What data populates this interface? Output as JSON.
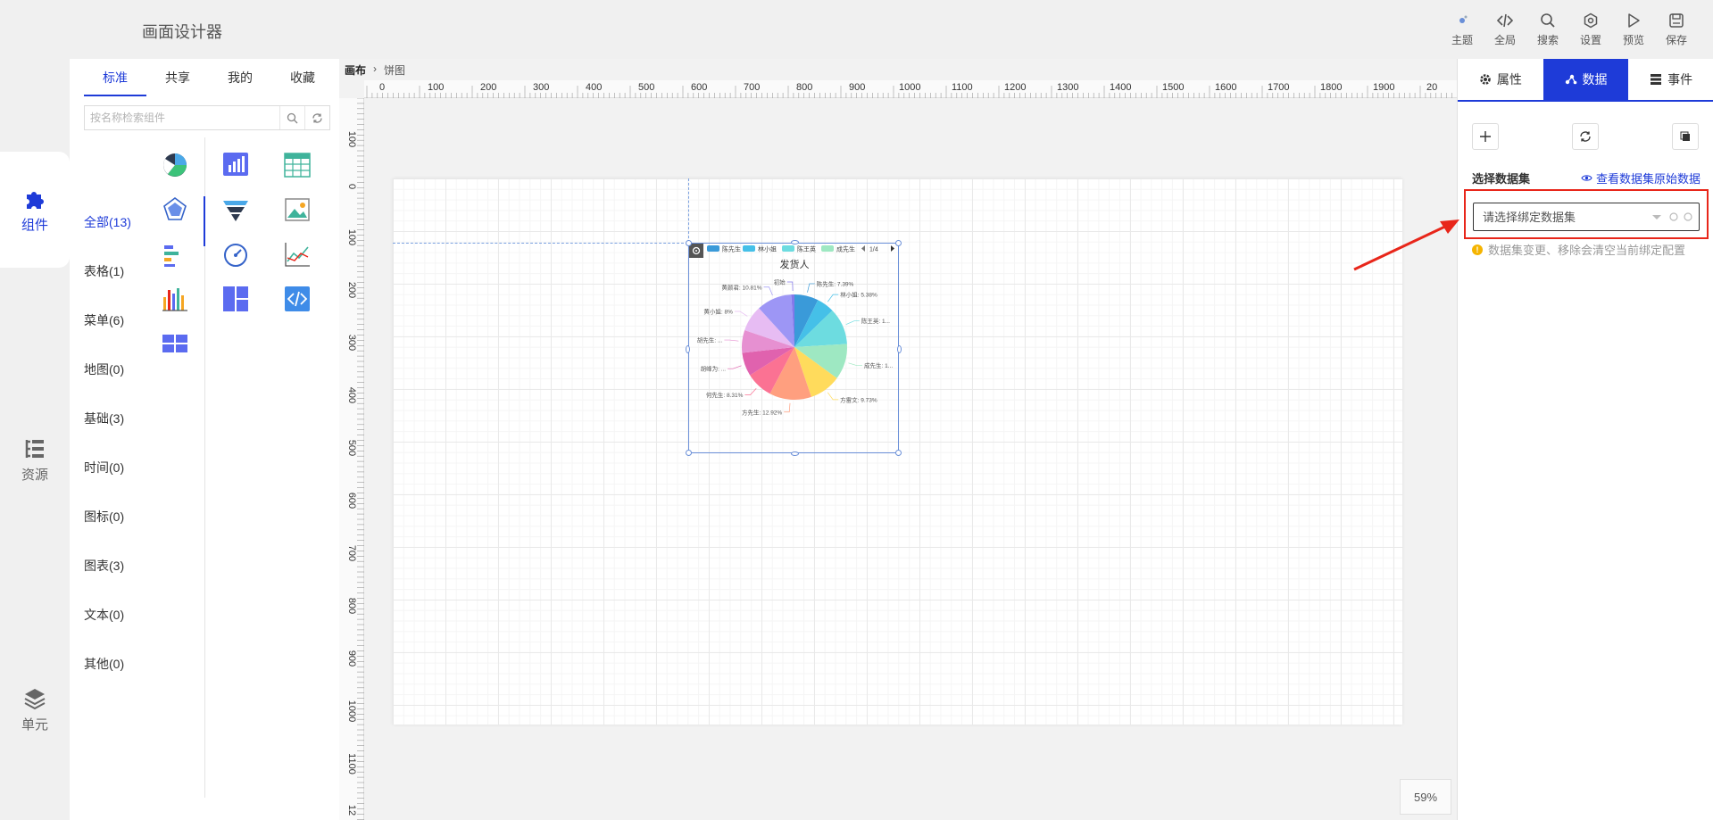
{
  "app_title": "画面设计器",
  "toolbar": [
    {
      "label": "主题",
      "icon": "theme-icon"
    },
    {
      "label": "全局",
      "icon": "code-icon"
    },
    {
      "label": "搜索",
      "icon": "search-icon"
    },
    {
      "label": "设置",
      "icon": "settings-icon"
    },
    {
      "label": "预览",
      "icon": "play-icon"
    },
    {
      "label": "保存",
      "icon": "save-icon"
    }
  ],
  "nav": [
    {
      "label": "组件",
      "icon": "puzzle-icon",
      "active": true
    },
    {
      "label": "资源",
      "icon": "tree-icon",
      "active": false
    },
    {
      "label": "单元",
      "icon": "layers-icon",
      "active": false
    }
  ],
  "panel": {
    "tabs": [
      "标准",
      "共享",
      "我的",
      "收藏"
    ],
    "search_placeholder": "按名称检索组件",
    "categories": [
      "全部(13)",
      "表格(1)",
      "菜单(6)",
      "地图(0)",
      "基础(3)",
      "时间(0)",
      "图标(0)",
      "图表(3)",
      "文本(0)",
      "其他(0)"
    ],
    "components": [
      "pie-chart-icon",
      "bar-chart-icon",
      "table-icon",
      "radar-chart-icon",
      "funnel-chart-icon",
      "image-icon",
      "gantt-icon",
      "gauge-icon",
      "line-chart-icon",
      "column-chart-icon",
      "layout-icon",
      "code-embed-icon",
      "grid-layout-icon"
    ]
  },
  "breadcrumb": [
    "画布",
    "饼图"
  ],
  "ruler": {
    "h": [
      "0",
      "100",
      "200",
      "300",
      "400",
      "500",
      "600",
      "700",
      "800",
      "900",
      "1000",
      "1100",
      "1200",
      "1300",
      "1400",
      "1500",
      "1600",
      "1700",
      "1800",
      "1900",
      "20"
    ],
    "v": [
      "100",
      "0",
      "100",
      "200",
      "300",
      "400",
      "500",
      "600",
      "700",
      "800",
      "900",
      "1000",
      "1100",
      "12"
    ]
  },
  "chart_data": {
    "type": "pie",
    "title": "发货人",
    "legend": [
      "陈先生",
      "林小姐",
      "陈王英",
      "成先生"
    ],
    "legend_page": "1/4",
    "categories": [
      "陈先生",
      "林小姐",
      "陈王英",
      "成先生",
      "方雷文",
      "方先生",
      "何先生",
      "胡峰为",
      "胡先生",
      "黄小姐",
      "黄颜君",
      "初始"
    ],
    "labels": [
      "陈先生: 7.39%",
      "林小姐: 5.38%",
      "陈王英: 1...",
      "成先生: 1...",
      "方雷文: 9.73%",
      "方先生: 12.92%",
      "何先生: 8.31%",
      "胡峰为: ...",
      "胡先生: ...",
      "黄小姐: 8%",
      "黄颜君: 10.81%",
      "初始"
    ],
    "values": [
      7.39,
      5.38,
      11.3,
      11.0,
      9.73,
      12.92,
      8.31,
      7.2,
      7.0,
      8,
      10.81,
      0.96
    ],
    "colors": [
      "#3a9ad9",
      "#45c0e8",
      "#6ddce0",
      "#9ee8c2",
      "#ffdb5c",
      "#ff9f7f",
      "#fb7293",
      "#e062ae",
      "#e690d1",
      "#e7bcf3",
      "#9d96f5",
      "#8378ea"
    ]
  },
  "zoom_label": "59%",
  "right_panel": {
    "tabs": [
      "属性",
      "数据",
      "事件"
    ],
    "section_label": "选择数据集",
    "view_link": "查看数据集原始数据",
    "select_placeholder": "请选择绑定数据集",
    "tip": "数据集变更、移除会清空当前绑定配置"
  }
}
